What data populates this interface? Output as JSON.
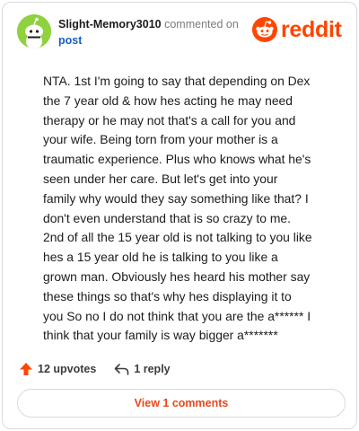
{
  "comment": {
    "username": "Slight-Memory3010",
    "action_text": "commented on",
    "target": "post",
    "body": "NTA. 1st I'm going to say that depending on Dex the 7 year old & how hes acting he may need therapy or he may not that's a call for you and your wife. Being torn from your mother is a traumatic experience. Plus who knows what he's seen under her care. But let's get into your family why would they say something like that? I don't even understand that is so crazy to me. 2nd of all the 15 year old is not talking to you like hes a 15 year old he is talking to you like a grown man. Obviously hes heard his mother say these things so that's why hes displaying it to you So no I do not think that you are the a****** I think that your family is way bigger a*******",
    "upvotes": "12 upvotes",
    "replies": "1 reply",
    "view_comments": "View 1 comments"
  },
  "brand": {
    "wordmark": "reddit",
    "accent": "#ff4500",
    "link_color": "#1a5ec9",
    "avatar_color": "#8fd13f"
  },
  "icons": {
    "avatar": "snoo-avatar",
    "logo": "reddit-snoo-icon",
    "upvote": "upvote-arrow-icon",
    "reply": "reply-arrow-icon"
  }
}
